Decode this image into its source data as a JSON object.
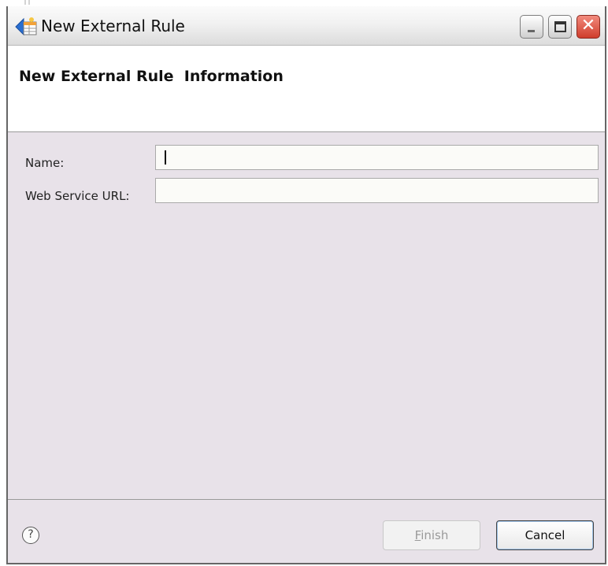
{
  "window": {
    "title": "New External Rule",
    "controls": [
      "minimize",
      "maximize",
      "close"
    ],
    "icons": {
      "app": "rule-table-icon",
      "help": "help-icon"
    }
  },
  "banner": {
    "title": "New External Rule  Information"
  },
  "form": {
    "name_label": "Name:",
    "name_value": "",
    "url_label": "Web Service URL:",
    "url_value": ""
  },
  "buttons": {
    "help_glyph": "?",
    "finish_label_mnemonic": "F",
    "finish_label_rest": "inish",
    "finish_enabled": false,
    "cancel_label": "Cancel"
  },
  "colors": {
    "dialog_bg": "#e8e2e9",
    "banner_bg": "#ffffff",
    "close_button": "#cf3d2c"
  }
}
